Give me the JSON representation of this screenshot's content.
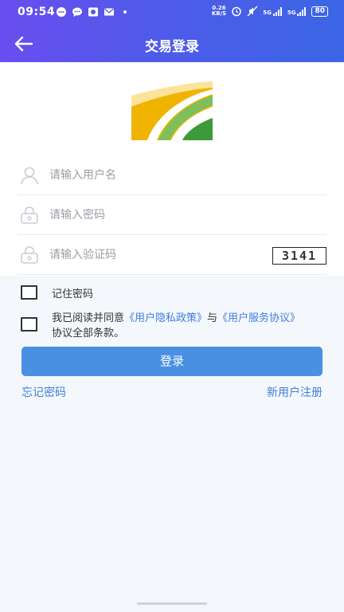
{
  "status_bar": {
    "time": "09:54",
    "speed_top": "0.26",
    "speed_bottom": "KB/S",
    "signal_1": "5G",
    "signal_2": "5G",
    "battery": "80",
    "left_icons": [
      "chat-bubble-icon",
      "message-icon",
      "camera-icon",
      "mail-icon",
      "dot-icon"
    ],
    "right_icons": [
      "alarm-icon",
      "mute-icon",
      "signal-icon",
      "signal-icon"
    ]
  },
  "header": {
    "title": "交易登录",
    "back_icon": "arrow-left-icon",
    "gradient_start": "#6a4df0",
    "gradient_end": "#3b66e6"
  },
  "form": {
    "username_placeholder": "请输入用户名",
    "password_placeholder": "请输入密码",
    "captcha_placeholder": "请输入验证码",
    "captcha_code": "3141"
  },
  "remember": {
    "label": "记住密码"
  },
  "agreement": {
    "prefix": "我已阅读并同意",
    "privacy_link": "《用户隐私政策》",
    "connector": "与",
    "service_link": "《用户服务协议》",
    "suffix": "协议全部条款。"
  },
  "actions": {
    "login_label": "登录",
    "forgot_password": "忘记密码",
    "register": "新用户注册"
  },
  "colors": {
    "accent": "#4a90e2",
    "link": "#3e7fdc",
    "logo_yellow": "#f0b400",
    "logo_green": "#3d9a3a"
  }
}
